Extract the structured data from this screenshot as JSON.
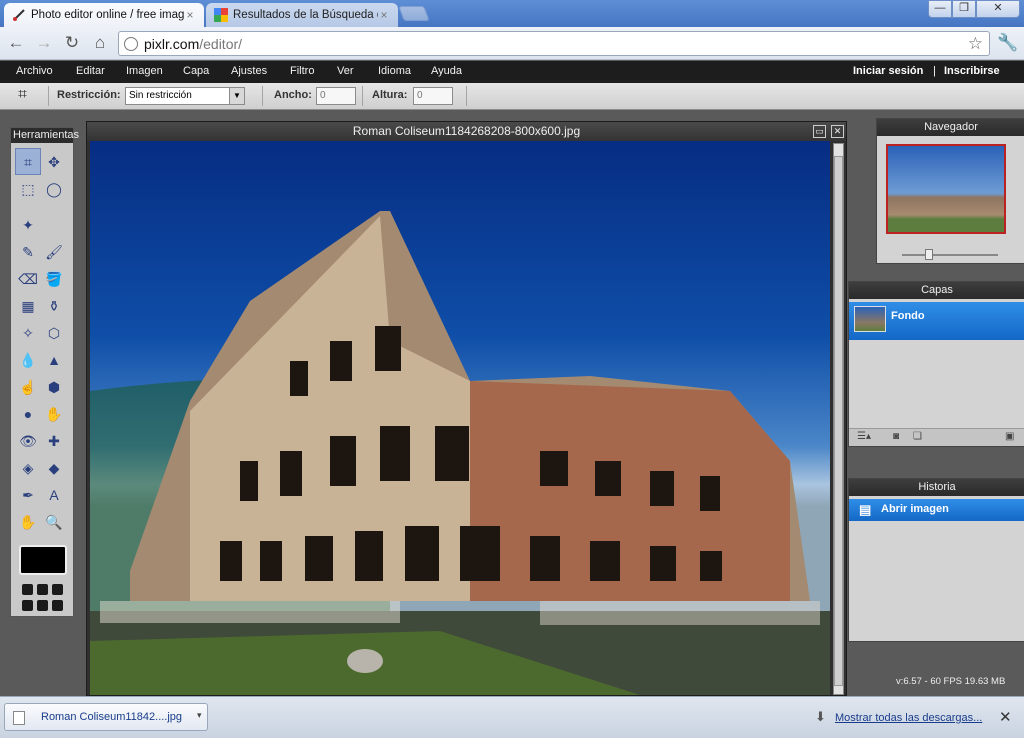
{
  "browser": {
    "tabs": [
      {
        "label": "Photo editor online / free imag",
        "close": "×"
      },
      {
        "label": "Resultados de la Búsqueda de",
        "close": "×"
      }
    ],
    "window_controls": {
      "min": "—",
      "max": "❐",
      "close": "✕"
    },
    "url_host": "pixlr.com",
    "url_path": "/editor/"
  },
  "menubar": {
    "items": [
      "Archivo",
      "Editar",
      "Imagen",
      "Capa",
      "Ajustes",
      "Filtro",
      "Ver",
      "Idioma",
      "Ayuda"
    ],
    "login": "Iniciar sesión",
    "separator": "|",
    "register": "Inscribirse"
  },
  "options": {
    "restriction_label": "Restricción:",
    "restriction_value": "Sin restricción",
    "width_label": "Ancho:",
    "width_value": "0",
    "height_label": "Altura:",
    "height_value": "0"
  },
  "tools_panel": {
    "title": "Herramientas",
    "tools": [
      {
        "name": "crop-tool",
        "glyph": "⌗"
      },
      {
        "name": "move-tool",
        "glyph": "✥"
      },
      {
        "name": "marquee-tool",
        "glyph": "⬚"
      },
      {
        "name": "lasso-tool",
        "glyph": "◯"
      },
      {
        "name": "wand-tool",
        "glyph": "✦"
      },
      {
        "name": "empty",
        "glyph": ""
      },
      {
        "name": "pencil-tool",
        "glyph": "✎"
      },
      {
        "name": "brush-tool",
        "glyph": "🖌"
      },
      {
        "name": "eraser-tool",
        "glyph": "⌫"
      },
      {
        "name": "bucket-tool",
        "glyph": "🪣"
      },
      {
        "name": "gradient-tool",
        "glyph": "▦"
      },
      {
        "name": "stamp-tool",
        "glyph": "⚱"
      },
      {
        "name": "replace-color-tool",
        "glyph": "✧"
      },
      {
        "name": "shape-tool",
        "glyph": "⬡"
      },
      {
        "name": "blur-tool",
        "glyph": "💧"
      },
      {
        "name": "sharpen-tool",
        "glyph": "▲"
      },
      {
        "name": "smudge-tool",
        "glyph": "☝"
      },
      {
        "name": "sponge-tool",
        "glyph": "⬢"
      },
      {
        "name": "burn-tool",
        "glyph": "●"
      },
      {
        "name": "dodge-tool",
        "glyph": "✋"
      },
      {
        "name": "redeye-tool",
        "glyph": "👁"
      },
      {
        "name": "spot-heal-tool",
        "glyph": "✚"
      },
      {
        "name": "bloat-tool",
        "glyph": "◈"
      },
      {
        "name": "pinch-tool",
        "glyph": "◆"
      },
      {
        "name": "eyedropper-tool",
        "glyph": "✒"
      },
      {
        "name": "text-tool",
        "glyph": "A"
      },
      {
        "name": "hand-tool",
        "glyph": "✋"
      },
      {
        "name": "zoom-tool",
        "glyph": "🔍"
      }
    ]
  },
  "image_window": {
    "title": "Roman Coliseum1184268208-800x600.jpg"
  },
  "navigator": {
    "title": "Navegador"
  },
  "layers": {
    "title": "Capas",
    "items": [
      "Fondo"
    ]
  },
  "history": {
    "title": "Historia",
    "items": [
      "Abrir imagen"
    ]
  },
  "status": {
    "version": "v:6.57 - 60 FPS 19.63 MB"
  },
  "downloads": {
    "file": "Roman Coliseum11842....jpg",
    "show_all": "Mostrar todas las descargas..."
  },
  "colors": {
    "accent_blue": "#1468c6",
    "menubar_bg": "#1d1d1d",
    "chrome_frame": "#4676c2"
  }
}
